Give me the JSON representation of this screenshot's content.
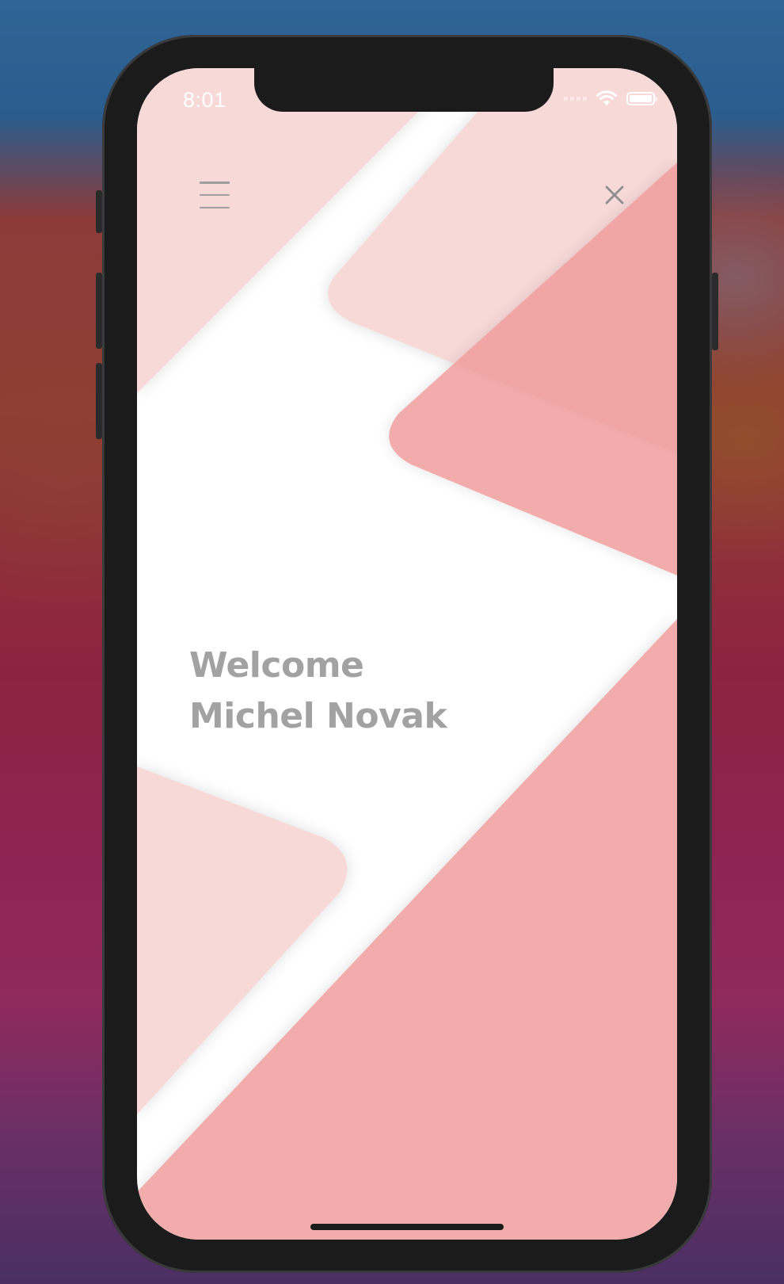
{
  "status_bar": {
    "time": "8:01",
    "icons": [
      "signal-icon",
      "wifi-icon",
      "battery-icon"
    ]
  },
  "header": {
    "menu_icon": "hamburger-menu-icon",
    "close_icon": "close-icon"
  },
  "welcome": {
    "line1": "Welcome",
    "line2": "Michel Novak"
  },
  "colors": {
    "pink_light": "#f7d9d8",
    "pink_mid": "#f2acac",
    "pink_dark": "#f09b9b",
    "text_gray": "#a2a2a2",
    "phone_frame": "#1b1b1c"
  }
}
